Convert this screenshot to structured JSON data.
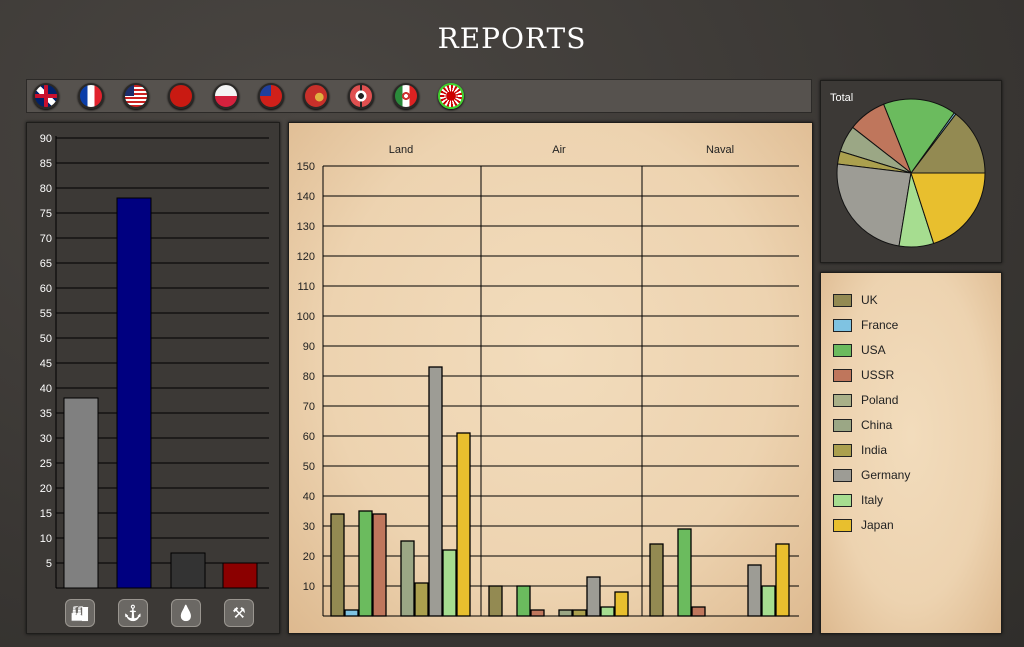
{
  "header": {
    "title": "REPORTS"
  },
  "flags": [
    {
      "name": "uk",
      "selected": false
    },
    {
      "name": "france",
      "selected": false
    },
    {
      "name": "usa",
      "selected": false
    },
    {
      "name": "ussr",
      "selected": false
    },
    {
      "name": "poland",
      "selected": false
    },
    {
      "name": "china",
      "selected": false
    },
    {
      "name": "india",
      "selected": false
    },
    {
      "name": "germany",
      "selected": false
    },
    {
      "name": "italy",
      "selected": false
    },
    {
      "name": "japan",
      "selected": true
    }
  ],
  "resource_buttons": [
    {
      "icon": "factory-icon",
      "glyph": "🏭"
    },
    {
      "icon": "anchor-icon",
      "glyph": "⚓"
    },
    {
      "icon": "oil-drop-icon",
      "glyph": "💧"
    },
    {
      "icon": "mining-tools-icon",
      "glyph": "⚒"
    }
  ],
  "countries": [
    "UK",
    "France",
    "USA",
    "USSR",
    "Poland",
    "China",
    "India",
    "Germany",
    "Italy",
    "Japan"
  ],
  "colors": {
    "UK": "#938a52",
    "France": "#7fc3e2",
    "USA": "#6bbb5e",
    "USSR": "#bf765c",
    "Poland": "#a9b088",
    "China": "#9ba785",
    "India": "#aba04e",
    "Germany": "#9d9c95",
    "Italy": "#a6dd90",
    "Japan": "#e8bf2e"
  },
  "chart_data": [
    {
      "type": "bar",
      "title": "",
      "ylim": [
        0,
        90
      ],
      "yticks": [
        5,
        10,
        15,
        20,
        25,
        30,
        35,
        40,
        45,
        50,
        55,
        60,
        65,
        70,
        75,
        80,
        85,
        90
      ],
      "categories": [
        "Factories",
        "Naval",
        "Oil",
        "Resources"
      ],
      "values": [
        38,
        78,
        7,
        5
      ],
      "bar_colors": [
        "#808080",
        "#000080",
        "#333333",
        "#8b0000"
      ]
    },
    {
      "type": "bar",
      "ylim": [
        0,
        150
      ],
      "yticks": [
        10,
        20,
        30,
        40,
        50,
        60,
        70,
        80,
        90,
        100,
        110,
        120,
        130,
        140,
        150
      ],
      "categories": [
        "Land",
        "Air",
        "Naval"
      ],
      "series": [
        {
          "name": "UK",
          "values": [
            34,
            10,
            24
          ]
        },
        {
          "name": "France",
          "values": [
            2,
            0,
            0
          ]
        },
        {
          "name": "USA",
          "values": [
            35,
            10,
            29
          ]
        },
        {
          "name": "USSR",
          "values": [
            34,
            2,
            3
          ]
        },
        {
          "name": "Poland",
          "values": [
            0,
            0,
            0
          ]
        },
        {
          "name": "China",
          "values": [
            25,
            2,
            0
          ]
        },
        {
          "name": "India",
          "values": [
            11,
            2,
            0
          ]
        },
        {
          "name": "Germany",
          "values": [
            83,
            13,
            17
          ]
        },
        {
          "name": "Italy",
          "values": [
            22,
            3,
            10
          ]
        },
        {
          "name": "Japan",
          "values": [
            61,
            8,
            24
          ]
        }
      ]
    },
    {
      "type": "pie",
      "title": "Total",
      "labels": [
        "UK",
        "France",
        "USA",
        "USSR",
        "Poland",
        "China",
        "India",
        "Germany",
        "Italy",
        "Japan"
      ],
      "values": [
        68,
        2,
        74,
        39,
        0,
        27,
        13,
        113,
        35,
        93
      ]
    }
  ]
}
